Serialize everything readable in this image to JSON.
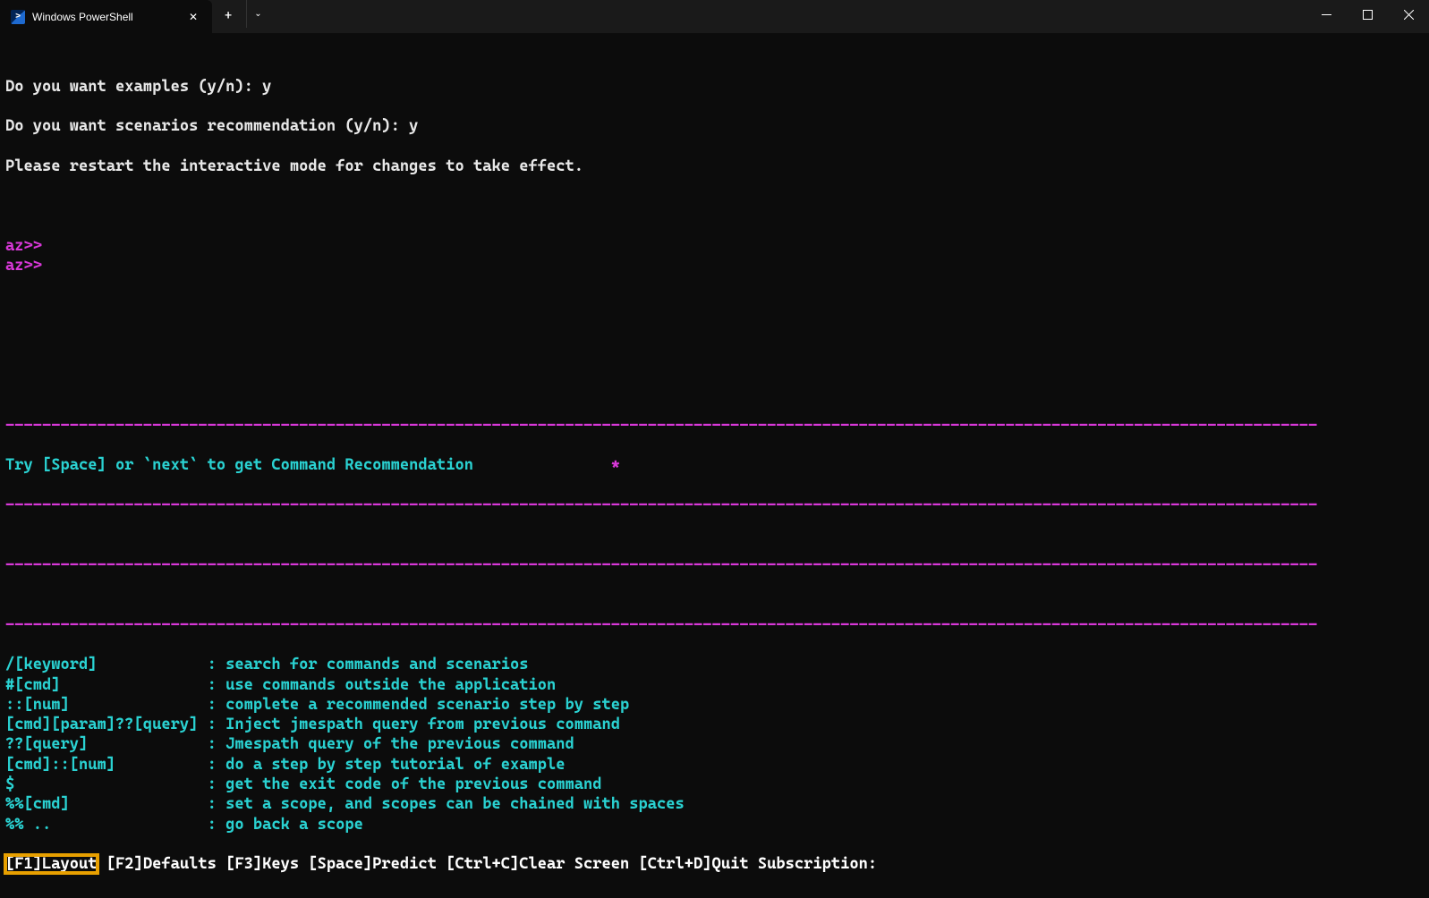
{
  "titlebar": {
    "tab_title": "Windows PowerShell"
  },
  "terminal": {
    "line1": "Do you want examples (y/n): y",
    "line2": "Do you want scenarios recommendation (y/n): y",
    "line3": "Please restart the interactive mode for changes to take effect.",
    "prompt1": "az>>",
    "prompt2": "az>>",
    "recommendation_text": "Try [Space] or `next` to get Command Recommendation",
    "star": "*",
    "help": [
      {
        "cmd": "/[keyword]           ",
        "desc": ": search for commands and scenarios"
      },
      {
        "cmd": "#[cmd]               ",
        "desc": ": use commands outside the application"
      },
      {
        "cmd": "::[num]              ",
        "desc": ": complete a recommended scenario step by step"
      },
      {
        "cmd": "[cmd][param]??[query]",
        "desc": ": Inject jmespath query from previous command"
      },
      {
        "cmd": "??[query]            ",
        "desc": ": Jmespath query of the previous command"
      },
      {
        "cmd": "[cmd]::[num]         ",
        "desc": ": do a step by step tutorial of example"
      },
      {
        "cmd": "$                    ",
        "desc": ": get the exit code of the previous command"
      },
      {
        "cmd": "%%[cmd]              ",
        "desc": ": set a scope, and scopes can be chained with spaces"
      },
      {
        "cmd": "%% ..                ",
        "desc": ": go back a scope"
      }
    ],
    "bottom_bar": {
      "f1": "[F1]Layout",
      "rest": " [F2]Defaults [F3]Keys [Space]Predict [Ctrl+C]Clear Screen [Ctrl+D]Quit Subscription:"
    },
    "dashes": "-----------------------------------------------------------------------------------------------------------------------------------------------"
  }
}
